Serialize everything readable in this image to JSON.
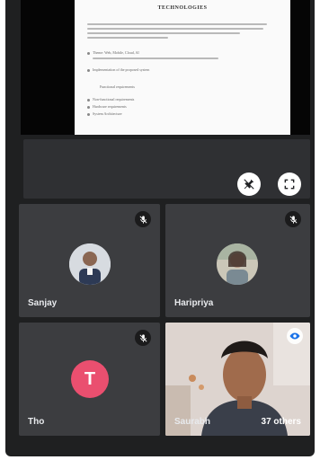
{
  "document": {
    "title": "TECHNOLOGIES",
    "bullets": [
      "Theme: Web, Mobile, Cloud, AI",
      "Implementation of the proposed system",
      "Functional requirements",
      "Non-functional requirements",
      "Hardware requirements",
      "System Architecture"
    ]
  },
  "controls": {
    "pin_icon": "pin-off-icon",
    "fullscreen_icon": "fullscreen-icon"
  },
  "participants": [
    {
      "name": "Sanjay",
      "muted": true,
      "avatar": "photo"
    },
    {
      "name": "Haripriya",
      "muted": true,
      "avatar": "photo"
    },
    {
      "name": "Tho",
      "muted": true,
      "avatar_letter": "T",
      "avatar_color": "#ea4f6f"
    },
    {
      "name": "Saurabh",
      "others_label": "37 others",
      "video": true
    }
  ],
  "colors": {
    "panel": "#1f2021",
    "tile": "#3c3d40",
    "accent_avatar": "#ea4f6f"
  }
}
